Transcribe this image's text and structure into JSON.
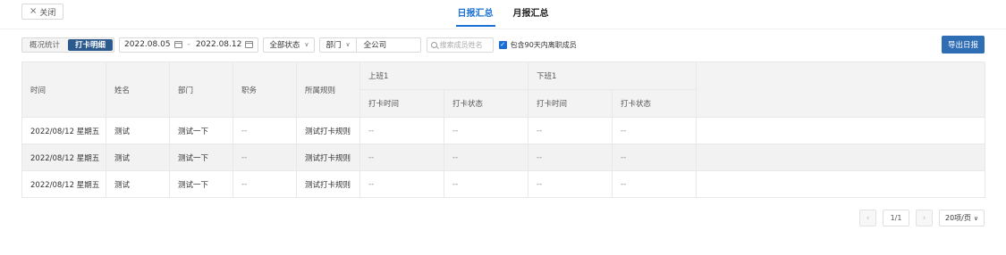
{
  "header": {
    "close_label": "关闭",
    "tabs": [
      {
        "label": "日报汇总",
        "active": true
      },
      {
        "label": "月报汇总",
        "active": false
      }
    ]
  },
  "toolbar": {
    "segments": [
      {
        "label": "概况统计",
        "active": false
      },
      {
        "label": "打卡明细",
        "active": true
      }
    ],
    "date_start": "2022.08.05",
    "date_sep": "-",
    "date_end": "2022.08.12",
    "status_select": "全部状态",
    "dept_select": "部门",
    "dept_value": "全公司",
    "search_placeholder": "搜索成员姓名",
    "checkbox_label": "包含90天内离职成员",
    "checkbox_checked": true,
    "export_label": "导出日报"
  },
  "table": {
    "headers": {
      "time": "时间",
      "name": "姓名",
      "dept": "部门",
      "position": "职务",
      "rule": "所属规则",
      "shift_on": "上班1",
      "shift_off": "下班1",
      "on_time": "打卡时间",
      "on_status": "打卡状态",
      "off_time": "打卡时间",
      "off_status": "打卡状态"
    },
    "rows": [
      {
        "time": "2022/08/12 星期五",
        "name": "测试",
        "dept": "测试一下",
        "position": "--",
        "rule": "测试打卡规则",
        "on_time": "--",
        "on_status": "--",
        "off_time": "--",
        "off_status": "--"
      },
      {
        "time": "2022/08/12 星期五",
        "name": "测试",
        "dept": "测试一下",
        "position": "--",
        "rule": "测试打卡规则",
        "on_time": "--",
        "on_status": "--",
        "off_time": "--",
        "off_status": "--"
      },
      {
        "time": "2022/08/12 星期五",
        "name": "测试",
        "dept": "测试一下",
        "position": "--",
        "rule": "测试打卡规则",
        "on_time": "--",
        "on_status": "--",
        "off_time": "--",
        "off_status": "--"
      }
    ]
  },
  "pagination": {
    "prev": "‹",
    "next": "›",
    "page": "1/1",
    "page_size": "20项/页"
  },
  "colors": {
    "accent": "#1a6fd6",
    "segment_active": "#2c5a8c",
    "export_button": "#2f6db5"
  }
}
